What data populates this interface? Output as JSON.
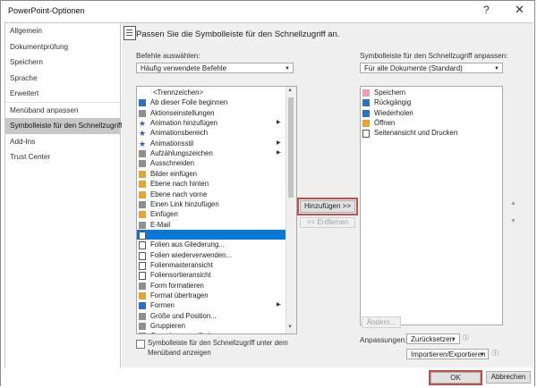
{
  "window": {
    "title": "PowerPoint-Optionen",
    "help": "?",
    "close": "✕"
  },
  "nav": {
    "items": [
      {
        "label": "Allgemein"
      },
      {
        "label": "Dokumentprüfung"
      },
      {
        "label": "Speichern"
      },
      {
        "label": "Sprache"
      },
      {
        "label": "Erweitert"
      },
      {
        "label": "Menüband anpassen"
      },
      {
        "label": "Symbolleiste für den Schnellzugriff"
      },
      {
        "label": "Add-Ins"
      },
      {
        "label": "Trust Center"
      }
    ],
    "selected": "Symbolleiste für den Schnellzugriff"
  },
  "main": {
    "header": "Passen Sie die Symbolleiste für den Schnellzugriff an.",
    "left": {
      "label": "Befehle auswählen:",
      "dropdown": "Häufig verwendete Befehle",
      "commands": [
        {
          "label": "<Trennzeichen>",
          "icon": "none"
        },
        {
          "label": "Ab dieser Folie beginnen",
          "icon": "slideshow-icon"
        },
        {
          "label": "Aktionseinstellungen",
          "icon": "action-icon"
        },
        {
          "label": "Animation hinzufügen",
          "icon": "star-icon",
          "submenu": true
        },
        {
          "label": "Animationsbereich",
          "icon": "star-icon"
        },
        {
          "label": "Animationsstil",
          "icon": "star-icon",
          "submenu": true
        },
        {
          "label": "Aufzählungszeichen",
          "icon": "bullets-icon",
          "submenu": true
        },
        {
          "label": "Ausschneiden",
          "icon": "scissors-icon"
        },
        {
          "label": "Bilder einfügen",
          "icon": "picture-icon"
        },
        {
          "label": "Ebene nach hinten",
          "icon": "layer-icon"
        },
        {
          "label": "Ebene nach vorne",
          "icon": "layer-icon"
        },
        {
          "label": "Einen Link hinzufügen",
          "icon": "link-icon"
        },
        {
          "label": "Einfügen",
          "icon": "paste-icon"
        },
        {
          "label": "E-Mail",
          "icon": "mail-icon"
        },
        {
          "label": "",
          "icon": "slide-icon",
          "selected": true
        },
        {
          "label": "Folien aus Gliederung...",
          "icon": "doc-icon"
        },
        {
          "label": "Folien wiederverwenden...",
          "icon": "doc-icon"
        },
        {
          "label": "Folienmasteransicht",
          "icon": "doc-icon"
        },
        {
          "label": "Foliensortieransicht",
          "icon": "doc-icon"
        },
        {
          "label": "Form formatieren",
          "icon": "format-icon"
        },
        {
          "label": "Format übertragen",
          "icon": "brush-icon"
        },
        {
          "label": "Formen",
          "icon": "shapes-icon",
          "submenu": true
        },
        {
          "label": "Größe und Position...",
          "icon": "size-icon"
        },
        {
          "label": "Gruppieren",
          "icon": "group-icon"
        },
        {
          "label": "Gruppierung aufheben",
          "icon": "group-icon"
        }
      ],
      "checkbox_line1": "Symbolleiste für den Schnellzugriff unter dem",
      "checkbox_line2": "Menüband anzeigen"
    },
    "buttons": {
      "add": "Hinzufügen >>",
      "remove": "<< Entfernen"
    },
    "right": {
      "label": "Symbolleiste für den Schnellzugriff anpassen:",
      "dropdown": "Für alle Dokumente (Standard)",
      "items": [
        {
          "label": "Speichern",
          "icon": "save-icon"
        },
        {
          "label": "Rückgängig",
          "icon": "undo-icon"
        },
        {
          "label": "Wiederholen",
          "icon": "redo-icon"
        },
        {
          "label": "Öffnen",
          "icon": "folder-icon"
        },
        {
          "label": "Seitenansicht und Drucken",
          "icon": "print-preview-icon"
        }
      ],
      "modify": "Ändern...",
      "customizations_label": "Anpassungen:",
      "reset": "Zurücksetzen",
      "import_export": "Importieren/Exportieren"
    }
  },
  "footer": {
    "ok": "OK",
    "cancel": "Abbrechen"
  }
}
